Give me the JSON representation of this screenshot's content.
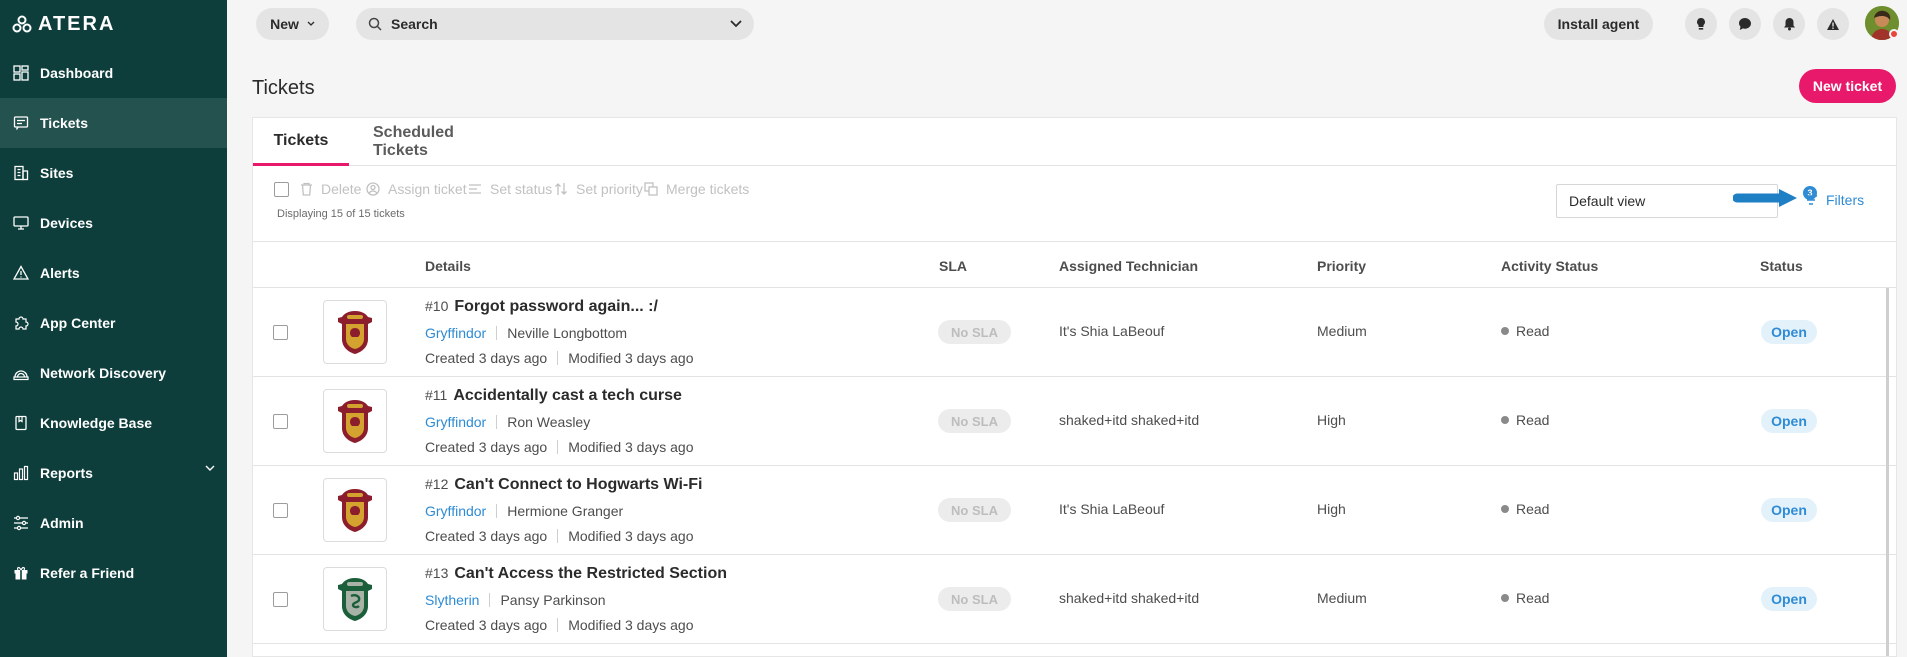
{
  "app": {
    "logo_text": "ATERA"
  },
  "sidebar": {
    "items": [
      {
        "label": "Dashboard",
        "icon": "dashboard-icon"
      },
      {
        "label": "Tickets",
        "icon": "ticket-icon",
        "active": true
      },
      {
        "label": "Sites",
        "icon": "building-icon"
      },
      {
        "label": "Devices",
        "icon": "monitor-icon"
      },
      {
        "label": "Alerts",
        "icon": "alert-triangle-icon"
      },
      {
        "label": "App Center",
        "icon": "puzzle-icon"
      },
      {
        "label": "Network Discovery",
        "icon": "network-icon"
      },
      {
        "label": "Knowledge Base",
        "icon": "book-icon"
      },
      {
        "label": "Reports",
        "icon": "bar-chart-icon",
        "has_chevron": true
      },
      {
        "label": "Admin",
        "icon": "sliders-icon"
      },
      {
        "label": "Refer a Friend",
        "icon": "gift-icon"
      }
    ]
  },
  "topbar": {
    "new_label": "New",
    "search_label": "Search",
    "install_label": "Install agent"
  },
  "page": {
    "title": "Tickets",
    "new_ticket_label": "New ticket"
  },
  "tabs": [
    "Tickets",
    "Scheduled Tickets"
  ],
  "toolbar": {
    "delete": "Delete",
    "assign": "Assign ticket",
    "set_status": "Set status",
    "set_priority": "Set priority",
    "merge": "Merge tickets",
    "displaying": "Displaying 15 of 15 tickets",
    "view": "Default view",
    "filters_label": "Filters",
    "filters_count": "3"
  },
  "columns": {
    "details": "Details",
    "sla": "SLA",
    "tech": "Assigned Technician",
    "priority": "Priority",
    "activity": "Activity Status",
    "status": "Status"
  },
  "tickets": [
    {
      "num": "#10",
      "title": "Forgot password again... :/",
      "house": "Gryffindor",
      "contact": "Neville Longbottom",
      "created": "Created 3 days ago",
      "modified": "Modified 3 days ago",
      "sla": "No SLA",
      "tech": "It's Shia LaBeouf",
      "priority": "Medium",
      "activity": "Read",
      "status": "Open",
      "crest": "gryffindor"
    },
    {
      "num": "#11",
      "title": "Accidentally cast a tech curse",
      "house": "Gryffindor",
      "contact": "Ron Weasley",
      "created": "Created 3 days ago",
      "modified": "Modified 3 days ago",
      "sla": "No SLA",
      "tech": "shaked+itd shaked+itd",
      "priority": "High",
      "activity": "Read",
      "status": "Open",
      "crest": "gryffindor"
    },
    {
      "num": "#12",
      "title": "Can't Connect to Hogwarts Wi-Fi",
      "house": "Gryffindor",
      "contact": "Hermione Granger",
      "created": "Created 3 days ago",
      "modified": "Modified 3 days ago",
      "sla": "No SLA",
      "tech": "It's Shia LaBeouf",
      "priority": "High",
      "activity": "Read",
      "status": "Open",
      "crest": "gryffindor"
    },
    {
      "num": "#13",
      "title": "Can't Access the Restricted Section",
      "house": "Slytherin",
      "contact": "Pansy Parkinson",
      "created": "Created 3 days ago",
      "modified": "Modified 3 days ago",
      "sla": "No SLA",
      "tech": "shaked+itd shaked+itd",
      "priority": "Medium",
      "activity": "Read",
      "status": "Open",
      "crest": "slytherin"
    }
  ],
  "colors": {
    "sidebar_bg": "#0e3e3b",
    "accent": "#e8196a",
    "link": "#2e8bd4"
  }
}
